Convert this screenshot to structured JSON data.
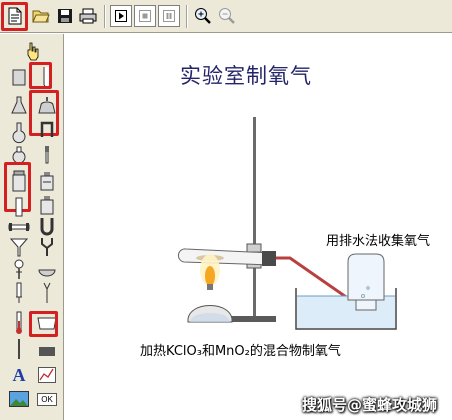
{
  "toolbar": {
    "buttons": [
      {
        "name": "new-document",
        "icon": "new-document-icon",
        "highlighted": true
      },
      {
        "name": "open-folder",
        "icon": "open-folder-icon"
      },
      {
        "name": "save",
        "icon": "floppy-disk-icon"
      },
      {
        "name": "print",
        "icon": "printer-icon"
      },
      {
        "name": "play",
        "icon": "play-icon"
      },
      {
        "name": "stop",
        "icon": "stop-icon"
      },
      {
        "name": "pause",
        "icon": "pause-icon"
      },
      {
        "name": "zoom-in",
        "icon": "zoom-in-icon"
      },
      {
        "name": "zoom-out",
        "icon": "zoom-out-icon"
      }
    ]
  },
  "palette": {
    "items": [
      "pointer-hand-icon",
      "beaker-icon",
      "test-tube-icon",
      "conical-flask-icon",
      "alcohol-lamp-icon",
      "round-flask-icon",
      "bent-tube-icon",
      "flask-icon",
      "dropper-icon",
      "gas-jar-icon",
      "reagent-bottle-icon",
      "tube-connector-icon",
      "u-tube-icon",
      "funnel-icon",
      "y-tube-icon",
      "separatory-funnel-icon",
      "evaporating-dish-icon",
      "burette-icon",
      "water-trough-icon",
      "thermometer-icon",
      "asbestos-gauze-icon",
      "text-tool-icon",
      "chart-tool-icon",
      "image-tool-icon",
      "ok-button-icon"
    ],
    "text_tool_label": "A",
    "ok_label": "OK"
  },
  "canvas": {
    "title": "实验室制氧气",
    "caption_left": "加热KClO₃和MnO₂的混合物制氧气",
    "caption_right": "用排水法收集氧气",
    "watermark": "搜狐号@蜜蜂攻城狮"
  },
  "colors": {
    "highlight": "#d42020",
    "title": "#24246a",
    "toolbar_bg": "#ece9d8",
    "water": "#dcecf8",
    "flame": "#f5a623"
  }
}
